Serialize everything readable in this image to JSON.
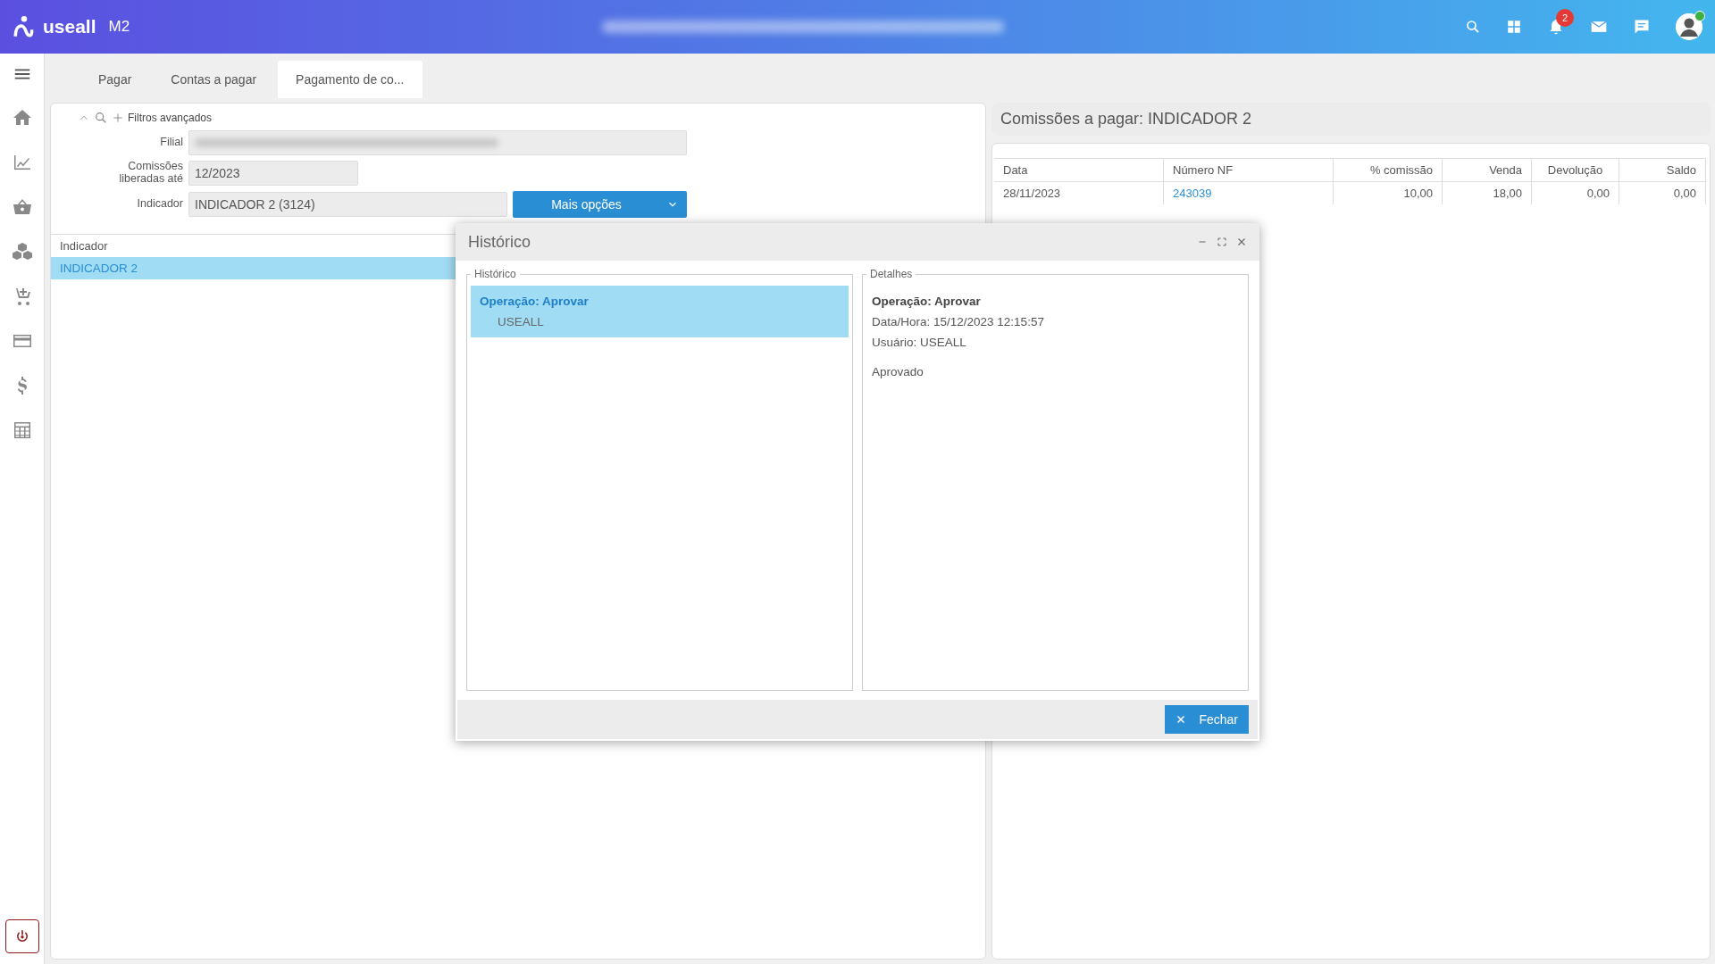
{
  "header": {
    "logo": "useall",
    "product": "M2",
    "notifications": "2"
  },
  "tabs": [
    {
      "label": "Pagar",
      "selected": false
    },
    {
      "label": "Contas a pagar",
      "selected": false
    },
    {
      "label": "Pagamento de co...",
      "selected": true
    }
  ],
  "filters": {
    "toggle": "Filtros avançados",
    "fields": [
      {
        "label": "Filial",
        "kind": "redacted"
      },
      {
        "label": "Comissões liberadas até",
        "value": "12/2023",
        "kind": "short"
      },
      {
        "label": "Indicador",
        "value": "INDICADOR 2 (3124)",
        "kind": "with_button"
      }
    ],
    "more_button": "Mais opções"
  },
  "indicator_list": {
    "column": "Indicador",
    "rows": [
      {
        "name": "INDICADOR 2",
        "selected": true
      }
    ]
  },
  "commissions": {
    "title": "Comissões a pagar: INDICADOR 2",
    "columns": [
      "Data",
      "Número NF",
      "% comissão",
      "Venda",
      "Devolução",
      "Saldo"
    ],
    "rows": [
      {
        "date": "28/11/2023",
        "nf": "243039",
        "commission": "10,00",
        "sale": "18,00",
        "return": "0,00",
        "balance": "0,00"
      }
    ]
  },
  "dialog": {
    "title": "Histórico",
    "history": {
      "legend": "Histórico",
      "items": [
        {
          "operation": "Operação: Aprovar",
          "user": "USEALL",
          "selected": true
        }
      ]
    },
    "details": {
      "legend": "Detalhes",
      "operation": "Operação: Aprovar",
      "datetime": "Data/Hora: 15/12/2023 12:15:57",
      "user": "Usuário: USEALL",
      "note": "Aprovado"
    },
    "close_button": "Fechar"
  }
}
